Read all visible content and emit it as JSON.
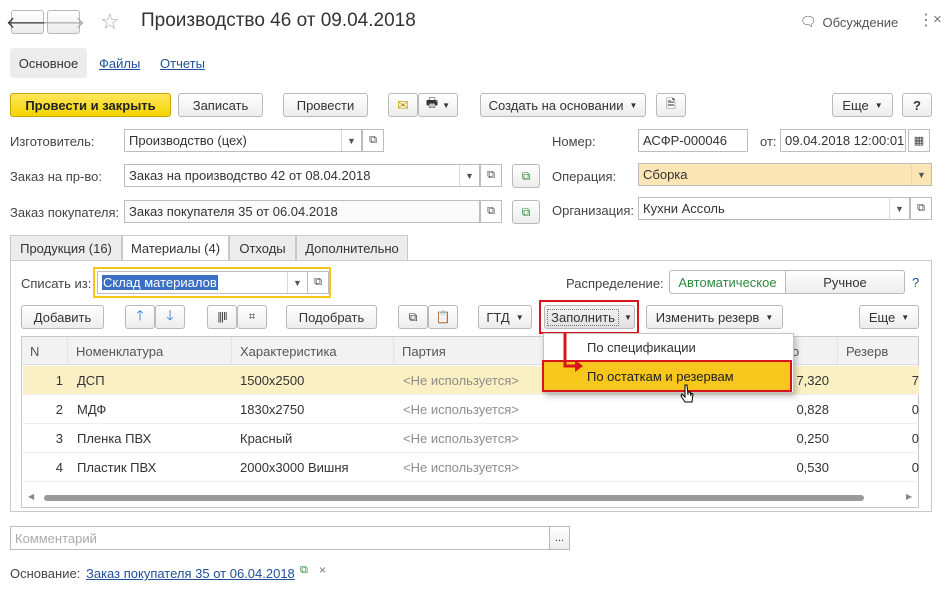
{
  "window": {
    "title": "Производство 46 от 09.04.2018",
    "discussion": "Обсуждение",
    "nav_tabs": [
      "Основное",
      "Файлы",
      "Отчеты"
    ]
  },
  "toolbar": {
    "post_close": "Провести и закрыть",
    "save": "Записать",
    "post": "Провести",
    "create_based": "Создать на основании",
    "more": "Еще",
    "help": "?"
  },
  "form": {
    "manufacturer_label": "Изготовитель:",
    "manufacturer_value": "Производство (цех)",
    "prod_order_label": "Заказ на пр-во:",
    "prod_order_value": "Заказ на производство 42 от 08.04.2018",
    "customer_order_label": "Заказ покупателя:",
    "customer_order_value": "Заказ покупателя 35 от 06.04.2018",
    "number_label": "Номер:",
    "number_value": "АСФР-000046",
    "date_label": "от:",
    "date_value": "09.04.2018 12:00:01",
    "operation_label": "Операция:",
    "operation_value": "Сборка",
    "org_label": "Организация:",
    "org_value": "Кухни Ассоль"
  },
  "tabs": [
    "Продукция (16)",
    "Материалы (4)",
    "Отходы",
    "Дополнительно"
  ],
  "materials": {
    "writeoff_label": "Списать из:",
    "writeoff_value": "Склад материалов",
    "distribution_label": "Распределение:",
    "dist_auto": "Автоматическое",
    "dist_manual": "Ручное",
    "help": "?",
    "add": "Добавить",
    "select": "Подобрать",
    "gtd": "ГТД",
    "fill": "Заполнить",
    "change_reserve": "Изменить резерв",
    "more": "Еще"
  },
  "fill_menu": [
    "По спецификации",
    "По остаткам и резервам"
  ],
  "table": {
    "headers": [
      "N",
      "Номенклатура",
      "Характеристика",
      "Партия",
      "о",
      "Резерв"
    ],
    "rows": [
      {
        "n": "1",
        "name": "ДСП",
        "char": "1500x2500",
        "batch": "<Не используется>",
        "qty": "7,320",
        "reserve": "7"
      },
      {
        "n": "2",
        "name": "МДФ",
        "char": "1830x2750",
        "batch": "<Не используется>",
        "qty": "0,828",
        "reserve": "0"
      },
      {
        "n": "3",
        "name": "Пленка ПВХ",
        "char": "Красный",
        "batch": "<Не используется>",
        "qty": "0,250",
        "reserve": "0"
      },
      {
        "n": "4",
        "name": "Пластик ПВХ",
        "char": "2000x3000 Вишня",
        "batch": "<Не используется>",
        "qty": "0,530",
        "reserve": "0"
      }
    ]
  },
  "footer": {
    "comment_placeholder": "Комментарий",
    "basis_label": "Основание:",
    "basis_link": "Заказ покупателя 35 от 06.04.2018"
  },
  "colors": {
    "accent_yellow": "#f5d400",
    "highlight_red": "#d9141b",
    "selected_row": "#fbf0c4",
    "link": "#1f4e9b",
    "green_text": "#2e8b3c"
  }
}
